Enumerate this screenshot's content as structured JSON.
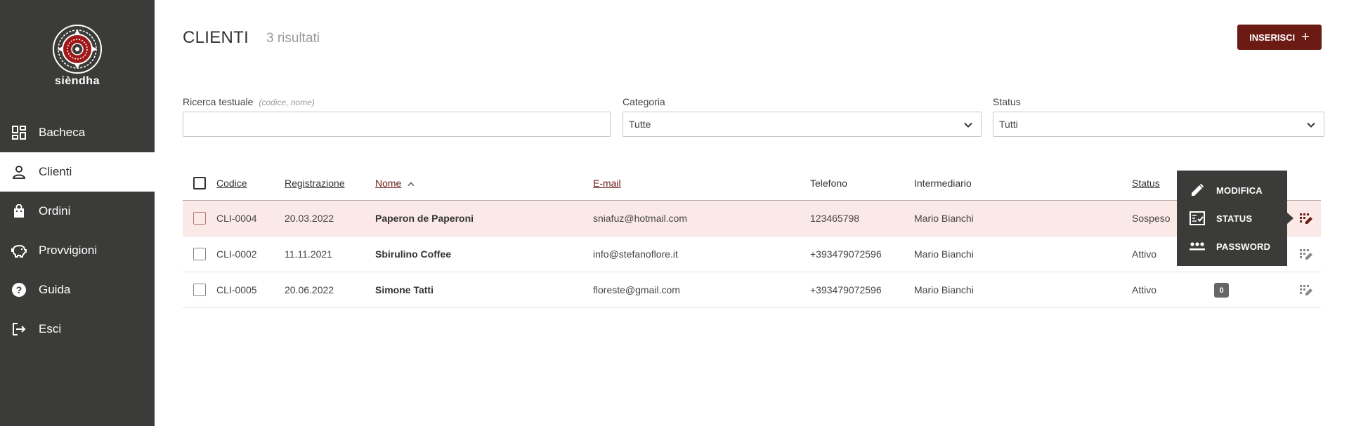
{
  "brand": {
    "name": "siendha_display",
    "display": "sièndha"
  },
  "sidebar": {
    "items": [
      {
        "label": "Bacheca",
        "icon": "dashboard-icon"
      },
      {
        "label": "Clienti",
        "icon": "person-icon"
      },
      {
        "label": "Ordini",
        "icon": "shopping-bag-icon"
      },
      {
        "label": "Provvigioni",
        "icon": "piggy-bank-icon"
      },
      {
        "label": "Guida",
        "icon": "help-icon"
      },
      {
        "label": "Esci",
        "icon": "logout-icon"
      }
    ],
    "active": "Clienti"
  },
  "header": {
    "title": "CLIENTI",
    "count": "3 risultati",
    "insert_label": "INSERISCI",
    "insert_icon": "+"
  },
  "filters": {
    "search_label": "Ricerca testuale",
    "search_hint": "(codice, nome)",
    "search_value": "",
    "category_label": "Categoria",
    "category_value": "Tutte",
    "status_label": "Status",
    "status_value": "Tutti"
  },
  "table": {
    "columns": [
      "Codice",
      "Registrazione",
      "Nome",
      "E-mail",
      "Telefono",
      "Intermediario",
      "Status"
    ],
    "sorted_by": "Nome",
    "rows": [
      {
        "code": "CLI-0004",
        "registration": "20.03.2022",
        "name": "Paperon de Paperoni",
        "email": "sniafuz@hotmail.com",
        "phone": "123465798",
        "intermediary": "Mario Bianchi",
        "status": "Sospeso",
        "badge": ""
      },
      {
        "code": "CLI-0002",
        "registration": "11.11.2021",
        "name": "Sbirulino Coffee",
        "email": "info@stefanoflore.it",
        "phone": "+393479072596",
        "intermediary": "Mario Bianchi",
        "status": "Attivo",
        "badge": ""
      },
      {
        "code": "CLI-0005",
        "registration": "20.06.2022",
        "name": "Simone Tatti",
        "email": "floreste@gmail.com",
        "phone": "+393479072596",
        "intermediary": "Mario Bianchi",
        "status": "Attivo",
        "badge": "0"
      }
    ]
  },
  "row_menu": {
    "items": [
      {
        "label": "MODIFICA",
        "icon": "pencil-icon"
      },
      {
        "label": "STATUS",
        "icon": "status-check-icon"
      },
      {
        "label": "PASSWORD",
        "icon": "password-dots-icon"
      }
    ]
  },
  "colors": {
    "sidebar_bg": "#3b3b39",
    "accent": "#6b1a14",
    "row_highlight": "#fbe9e8"
  }
}
